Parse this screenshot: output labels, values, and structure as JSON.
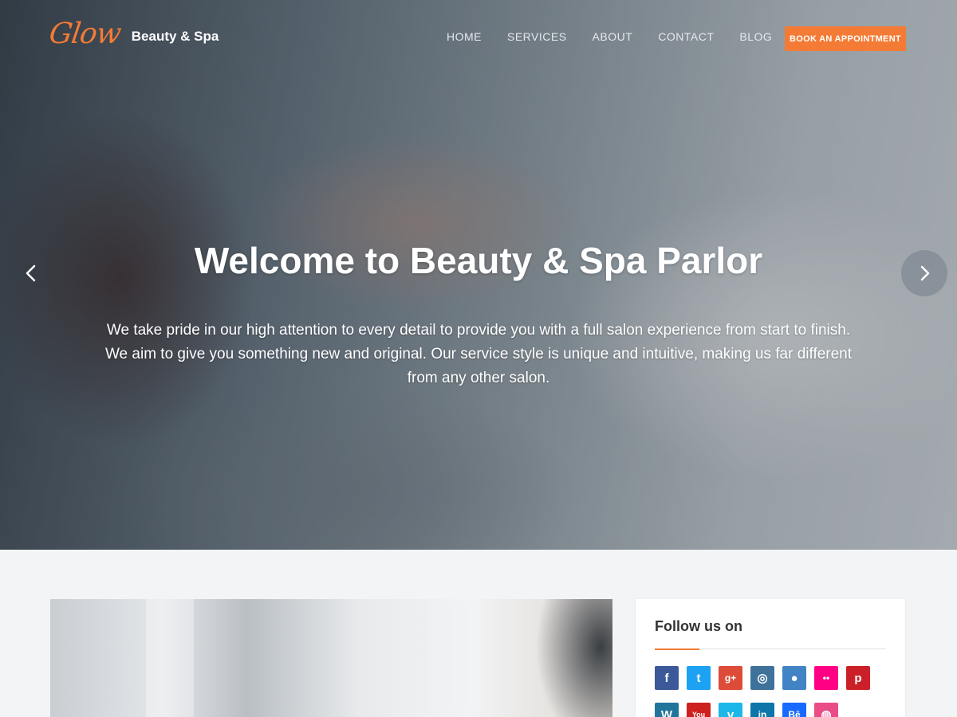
{
  "brand": {
    "script": "Glow",
    "name": "Beauty & Spa"
  },
  "nav": {
    "items": [
      "HOME",
      "SERVICES",
      "ABOUT",
      "CONTACT",
      "BLOG"
    ],
    "cta": "BOOK AN APPOINTMENT"
  },
  "hero": {
    "title": "Welcome to Beauty & Spa Parlor",
    "text": "We take pride in our high attention to every detail to provide you with a full salon experience from start to finish. We aim to give you something new and original. Our service style is unique and intuitive, making us far different from any other salon."
  },
  "sidebar": {
    "follow_title": "Follow us on",
    "social_row1": [
      {
        "icon": "facebook-icon",
        "glyph": "f",
        "color": "#3b5998"
      },
      {
        "icon": "twitter-icon",
        "glyph": "t",
        "color": "#1da1f2"
      },
      {
        "icon": "google-plus-icon",
        "glyph": "g+",
        "color": "#dd4b39"
      },
      {
        "icon": "instagram-icon",
        "glyph": "◎",
        "color": "#3f729b"
      },
      {
        "icon": "github-icon",
        "glyph": "●",
        "color": "#4183c4"
      },
      {
        "icon": "flickr-icon",
        "glyph": "••",
        "color": "#ff0084"
      },
      {
        "icon": "pinterest-icon",
        "glyph": "p",
        "color": "#cb2027"
      }
    ],
    "social_row2": [
      {
        "icon": "wordpress-icon",
        "glyph": "W",
        "color": "#21759b"
      },
      {
        "icon": "youtube-icon",
        "glyph": "You",
        "color": "#cd201f"
      },
      {
        "icon": "vimeo-icon",
        "glyph": "v",
        "color": "#1ab7ea"
      },
      {
        "icon": "linkedin-icon",
        "glyph": "in",
        "color": "#0e76a8"
      },
      {
        "icon": "behance-icon",
        "glyph": "Bē",
        "color": "#1769ff"
      },
      {
        "icon": "dribbble-icon",
        "glyph": "◍",
        "color": "#ea4c89"
      }
    ]
  }
}
